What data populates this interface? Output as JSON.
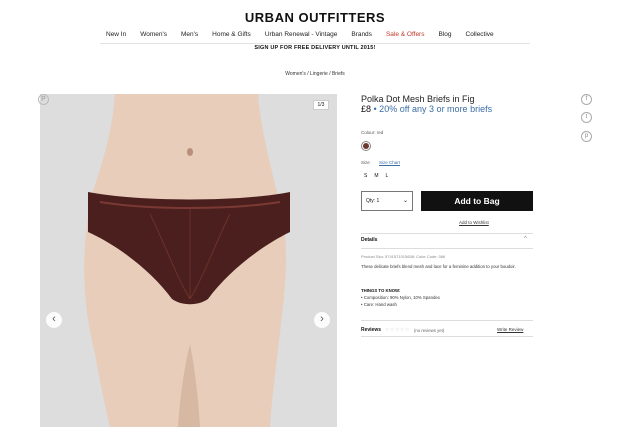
{
  "header": {
    "logo": "URBAN OUTFITTERS",
    "nav": [
      "New In",
      "Women's",
      "Men's",
      "Home & Gifts",
      "Urban Renewal - Vintage",
      "Brands",
      "Sale & Offers",
      "Blog",
      "Collective"
    ],
    "promo": "SIGN UP FOR FREE DELIVERY UNTIL 2015!"
  },
  "breadcrumb": "Women's / Lingerie / Briefs",
  "gallery": {
    "counter": "1/3"
  },
  "product": {
    "title": "Polka Dot Mesh Briefs in Fig",
    "price": "£8",
    "offer": "• 20% off any 3 or more briefs",
    "color_label": "Colour: red",
    "size_label": "Size",
    "size_chart": "Size Chart",
    "sizes": [
      "S",
      "M",
      "L"
    ],
    "qty": "Qty: 1",
    "add_to_bag": "Add to Bag",
    "wishlist": "Add to Wishlist"
  },
  "details": {
    "heading": "Details",
    "code": "Product Sku: 5741571015658; Color Code: 066",
    "description": "These delicate briefs blend mesh and lace for a feminine addition to your boudoir.",
    "things_heading": "THINGS TO KNOW:",
    "bullets": [
      "• Composition: 90% Nylon, 10% Spandex",
      "• Care: Hand wash"
    ]
  },
  "reviews": {
    "label": "Reviews",
    "stars": "☆☆☆☆☆",
    "count": "(no reviews yet)",
    "write": "Write Review"
  },
  "colors": {
    "sale": "#c0392b",
    "offer": "#3a6ea5",
    "button": "#111111",
    "swatch": "#6b3a2e"
  }
}
